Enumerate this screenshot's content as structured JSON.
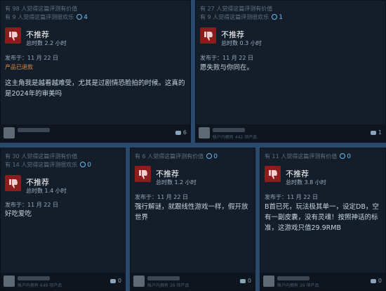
{
  "cards": [
    {
      "helpful": "有 98 人觉得这篇评测有价值",
      "funny": "有 9 人觉得这篇评测很欢乐",
      "award_count": "4",
      "verdict": "不推荐",
      "hours": "总时数 2.2 小时",
      "posted": "发布于：11 月 22 日",
      "refund": "产品已退款",
      "body": "这主角我是越看越难受，尤其是过剧情恐脸拍的时候。这真的是2024年的审美吗",
      "user_info": "",
      "comments": "6"
    },
    {
      "helpful": "有 27 人觉得这篇评测有价值",
      "funny": "有 9 人觉得这篇评测很欢乐",
      "award_count": "1",
      "verdict": "不推荐",
      "hours": "总时数 0.3 小时",
      "posted": "发布于：11 月 22 日",
      "body": "愿失败与你同在。",
      "user_info": "帐户内拥有 442 项产品",
      "comments": "1"
    },
    {
      "helpful": "有 30 人觉得这篇评测有价值",
      "funny": "有 14 人觉得这篇评测很欢乐",
      "award_count": "0",
      "verdict": "不推荐",
      "hours": "总时数 1.4 小时",
      "posted": "发布于：11 月 22 日",
      "body": "好吃爱吃",
      "user_info": "帐户内拥有 649 项产品",
      "comments": "0"
    },
    {
      "helpful": "有 6 人觉得这篇评测有价值",
      "award_count": "0",
      "verdict": "不推荐",
      "hours": "总时数 1.2 小时",
      "posted": "发布于：11 月 22 日",
      "body": "强行解谜，就跟线性游戏一样，假开放世界",
      "user_info": "帐户内拥有 26 项产品",
      "comments": "0"
    },
    {
      "helpful": "有 11 人觉得这篇评测有价值",
      "award_count": "0",
      "verdict": "不推荐",
      "hours": "总时数 3.8 小时",
      "posted": "发布于：11 月 22 日",
      "body": "B首已死，玩法极其单一，设定DB，空有一副皮囊，没有灵魂！按照神话的标准，这游戏只值29.9RMB",
      "user_info": "帐户内拥有 39 项产品",
      "comments": "0"
    }
  ]
}
